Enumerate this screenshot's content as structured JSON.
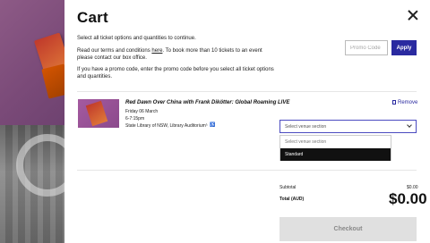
{
  "cart": {
    "title": "Cart",
    "intro": {
      "line1": "Select all ticket options and quantities to continue.",
      "line2_pre": "Read our terms and conditions ",
      "line2_link": "here",
      "line2_post": ". To book more than 10 tickets to an event please contact our box office.",
      "line3": "If you have a promo code, enter the promo code before you select all ticket options and quantities."
    },
    "promo": {
      "placeholder": "Promo Code",
      "apply_label": "Apply"
    },
    "item": {
      "title": "Red Dawn Over China with Frank Dikötter: Global Roaming LIVE",
      "date": "Friday 06 March",
      "time": "6-7:15pm",
      "venue": "State Library of NSW, Library Auditorium",
      "accessibility_icons": [
        "hearing-loop-icon",
        "wheelchair-icon"
      ],
      "remove_label": "Remove",
      "select": {
        "value": "Select venue section",
        "options": [
          "Select venue section",
          "Standard"
        ],
        "highlighted": "Standard"
      }
    },
    "summary": {
      "subtotal_label": "Subtotal",
      "subtotal_value": "$0.00",
      "total_label": "Total (AUD)",
      "total_value": "$0.00"
    },
    "checkout_label": "Checkout"
  },
  "colors": {
    "accent": "#2a2aa0",
    "disabled": "#e0e0e0"
  }
}
